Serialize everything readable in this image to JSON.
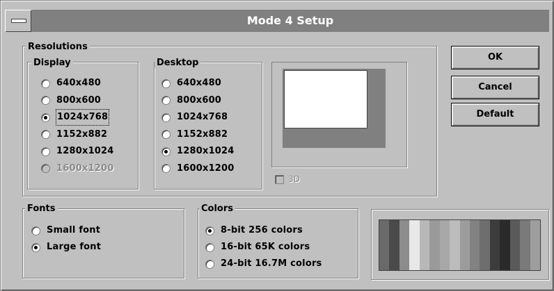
{
  "window": {
    "title": "Mode 4 Setup"
  },
  "resolutions": {
    "label": "Resolutions",
    "display": {
      "label": "Display",
      "options": [
        "640x480",
        "800x600",
        "1024x768",
        "1152x882",
        "1280x1024",
        "1600x1200"
      ],
      "selected": "1024x768",
      "disabled": [
        "1600x1200"
      ]
    },
    "desktop": {
      "label": "Desktop",
      "options": [
        "640x480",
        "800x600",
        "1024x768",
        "1152x882",
        "1280x1024",
        "1600x1200"
      ],
      "selected": "1280x1024"
    },
    "checkbox_3d": {
      "label": "3D",
      "checked": false,
      "disabled": true
    }
  },
  "buttons": {
    "ok": "OK",
    "cancel": "Cancel",
    "default": "Default"
  },
  "fonts": {
    "label": "Fonts",
    "options": [
      "Small font",
      "Large font"
    ],
    "selected": "Large font"
  },
  "colors": {
    "label": "Colors",
    "options": [
      "8-bit 256 colors",
      "16-bit 65K colors",
      "24-bit 16.7M colors"
    ],
    "selected": "8-bit 256 colors"
  },
  "palette_preview": {
    "colors": [
      "#6a6a6a",
      "#4a4a4a",
      "#8c8c8c",
      "#e8e8e8",
      "#b8b8b8",
      "#9a9a9a",
      "#a8a8a8",
      "#bcbcbc",
      "#9c9c9c",
      "#828282",
      "#6e6e6e",
      "#3c3c3c",
      "#2a2a2a",
      "#5a5a5a",
      "#7a7a7a",
      "#9e9e9e"
    ]
  }
}
